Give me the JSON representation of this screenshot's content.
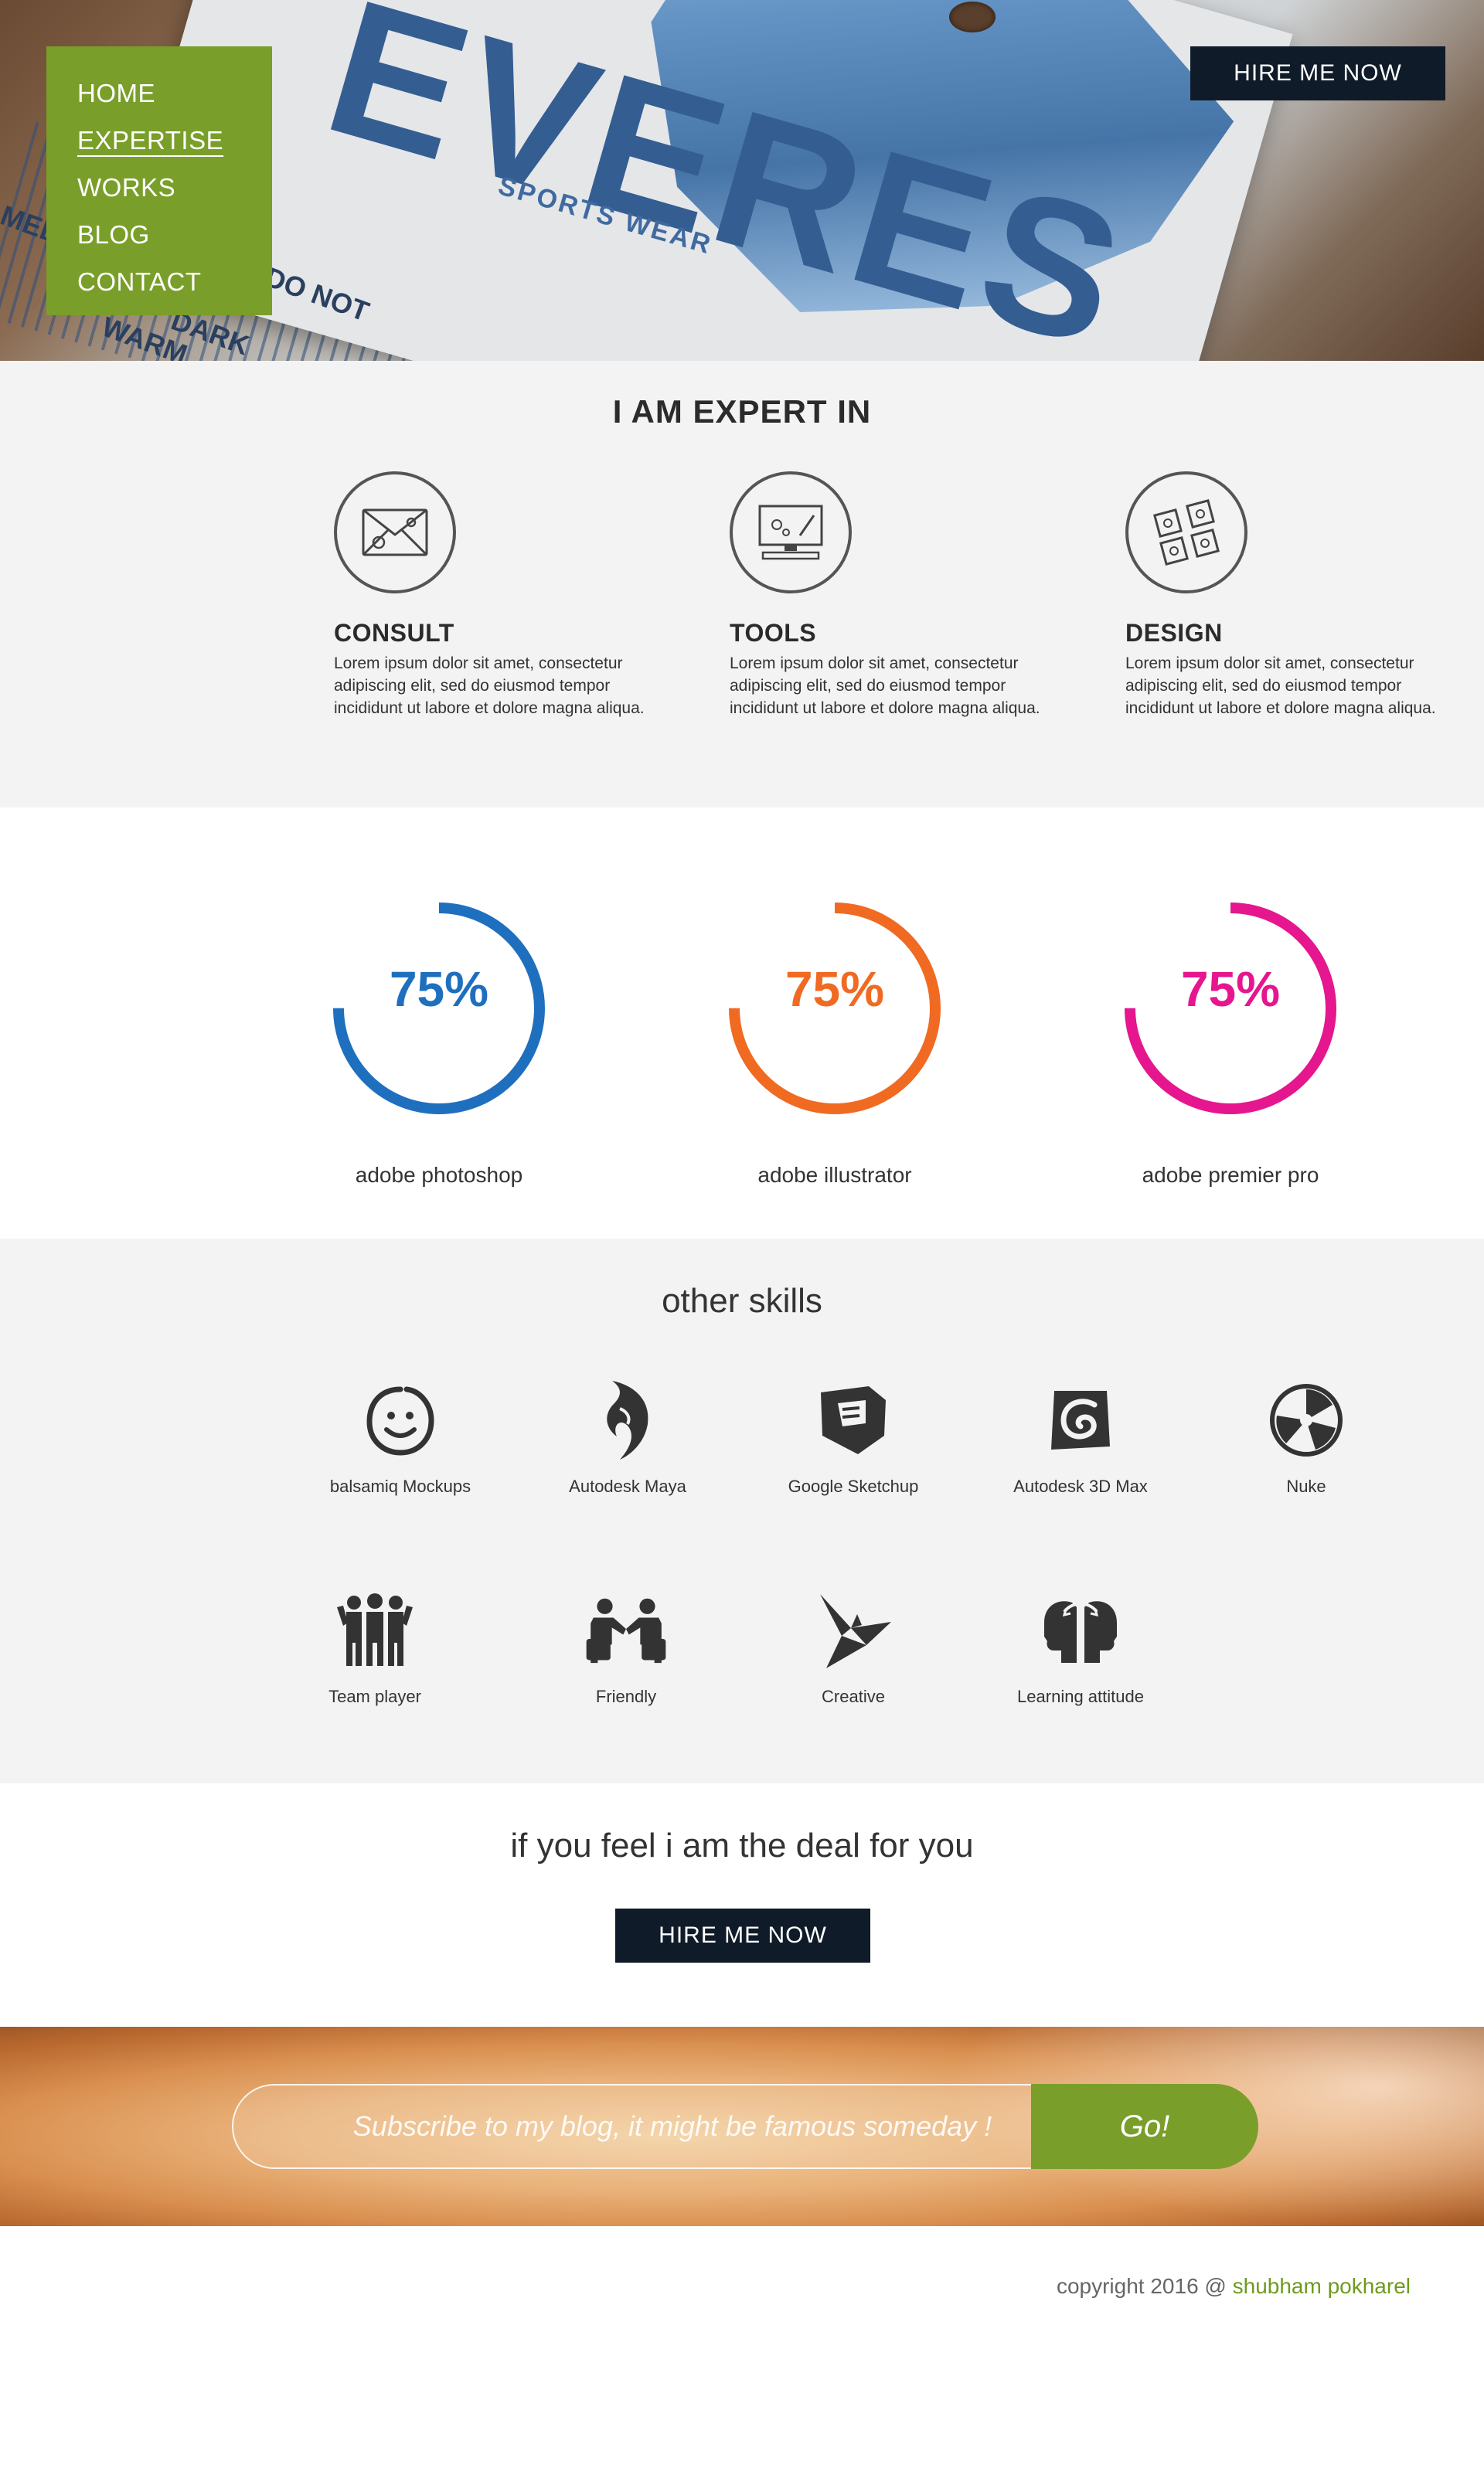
{
  "colors": {
    "nav_bg": "#7a9e2a",
    "dark_button": "#0f1b28",
    "section_bg": "#f4f3f4",
    "photoshop": "#1f6fbf",
    "illustrator": "#f06a22",
    "premiere": "#e5168e",
    "accent_green": "#6f9a1e"
  },
  "hero": {
    "brand": "EVERES",
    "brand_sub": "SPORTS WEAR",
    "tag_lines": [
      "DO NOT",
      "DARK",
      "WARM",
      "MED"
    ]
  },
  "nav": {
    "items": [
      {
        "label": "HOME"
      },
      {
        "label": "EXPERTISE",
        "active": true
      },
      {
        "label": "WORKS"
      },
      {
        "label": "BLOG"
      },
      {
        "label": "CONTACT"
      }
    ]
  },
  "header": {
    "hire_label": "HIRE ME NOW"
  },
  "expert": {
    "title": "I AM EXPERT IN",
    "columns": [
      {
        "icon": "envelope-icon",
        "title": "CONSULT",
        "text": "Lorem ipsum dolor sit amet, consectetur adipiscing elit, sed do eiusmod tempor incididunt ut labore et dolore magna aliqua."
      },
      {
        "icon": "monitor-icon",
        "title": "TOOLS",
        "text": "Lorem ipsum dolor sit amet, consectetur adipiscing elit, sed do eiusmod tempor incididunt ut labore et dolore magna aliqua."
      },
      {
        "icon": "design-tiles-icon",
        "title": "DESIGN",
        "text": "Lorem ipsum dolor sit amet, consectetur adipiscing elit, sed do eiusmod tempor incididunt ut labore et dolore magna aliqua."
      }
    ]
  },
  "software_skills": [
    {
      "label": "adobe photoshop",
      "value": 75,
      "display": "75%"
    },
    {
      "label": "adobe illustrator",
      "value": 75,
      "display": "75%"
    },
    {
      "label": "adobe premier pro",
      "value": 75,
      "display": "75%"
    }
  ],
  "other_skills": {
    "title": "other skills",
    "items": [
      {
        "icon": "smiley-icon",
        "label": "balsamiq Mockups"
      },
      {
        "icon": "maya-icon",
        "label": "Autodesk Maya"
      },
      {
        "icon": "sketchup-icon",
        "label": "Google Sketchup"
      },
      {
        "icon": "3ds-max-icon",
        "label": "Autodesk 3D Max"
      },
      {
        "icon": "nuke-icon",
        "label": "Nuke"
      },
      {
        "icon": "team-icon",
        "label": "Team player"
      },
      {
        "icon": "handshake-icon",
        "label": "Friendly"
      },
      {
        "icon": "origami-bird-icon",
        "label": "Creative"
      },
      {
        "icon": "brain-exchange-icon",
        "label": "Learning attitude"
      }
    ]
  },
  "cta": {
    "text": "if you feel i am the deal for you",
    "button_label": "HIRE ME NOW"
  },
  "subscribe": {
    "placeholder": "Subscribe to my blog, it might be famous someday !",
    "button_label": "Go!"
  },
  "footer": {
    "copyright_prefix": "copyright 2016 @ ",
    "author": "shubham pokharel"
  }
}
